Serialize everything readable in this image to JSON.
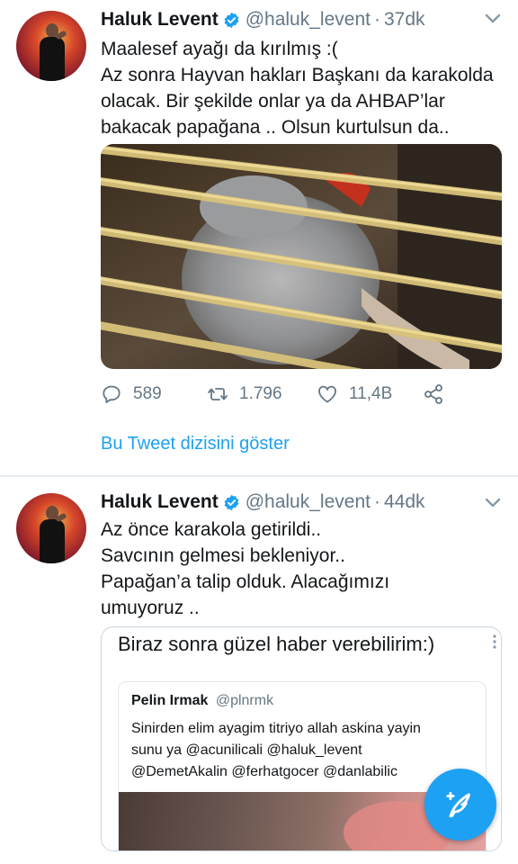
{
  "colors": {
    "accent": "#1da1f2",
    "text": "#14171a",
    "secondary": "#657786",
    "divider": "#e6ecf0"
  },
  "tweets": [
    {
      "author_name": "Haluk Levent",
      "handle": "@haluk_levent",
      "separator": "·",
      "time": "37dk",
      "lines": [
        "Maalesef ayağı da kırılmış :(",
        "Az sonra Hayvan hakları Başkanı da karakolda",
        "olacak. Bir şekilde onlar ya da AHBAP’lar",
        "bakacak papağana .. Olsun kurtulsun da.."
      ],
      "media_icon": "parrot-in-cage-photo",
      "actions": {
        "replies": "589",
        "retweets": "1.796",
        "likes": "11,4B"
      },
      "thread_link": "Bu Tweet dizisini göster"
    },
    {
      "author_name": "Haluk Levent",
      "handle": "@haluk_levent",
      "separator": "·",
      "time": "44dk",
      "lines": [
        "Az önce karakola getirildi..",
        "Savcının gelmesi bekleniyor..",
        "Papağan’a talip olduk. Alacağımızı",
        "umuyoruz .."
      ],
      "quote": {
        "headline": "Biraz sonra güzel haber verebilirim:)",
        "inner_name": "Pelin Irmak",
        "inner_handle": "@plnrmk",
        "inner_lines": [
          "Sinirden elim ayagim titriyo allah askina yayin",
          "sunu ya @acunilicali @haluk_levent",
          "@DemetAkalin @ferhatgocer @danlabilic"
        ]
      }
    }
  ],
  "fab_icon": "compose-feather-icon"
}
